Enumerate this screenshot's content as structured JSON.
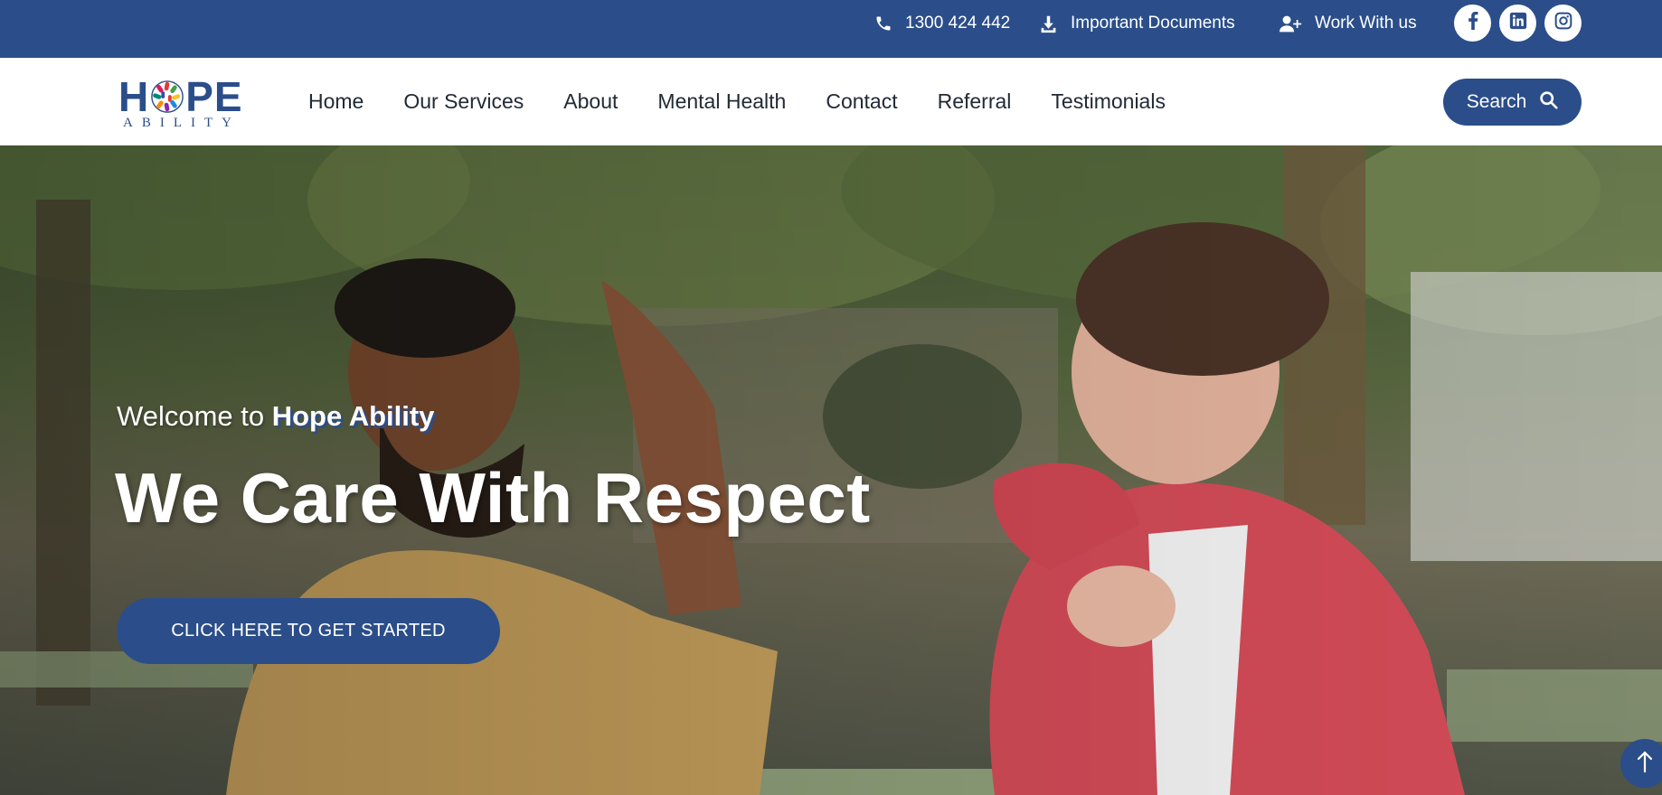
{
  "topbar": {
    "phone": "1300 424 442",
    "documents": "Important Documents",
    "work": "Work With us",
    "social": [
      "facebook-icon",
      "linkedin-icon",
      "instagram-icon"
    ],
    "color": "#2b4e8a"
  },
  "header": {
    "logo_main": "HOPE",
    "logo_sub": "ABILITY",
    "nav": [
      "Home",
      "Our Services",
      "About",
      "Mental Health",
      "Contact",
      "Referral",
      "Testimonials"
    ],
    "search_label": "Search"
  },
  "hero": {
    "welcome_prefix": "Welcome to",
    "welcome_brand": "Hope Ability",
    "headline": "We Care With Respect",
    "cta_label": "CLICK HERE TO GET STARTED"
  },
  "colors": {
    "brand": "#2b4e8a",
    "nav_text": "#222a35"
  }
}
